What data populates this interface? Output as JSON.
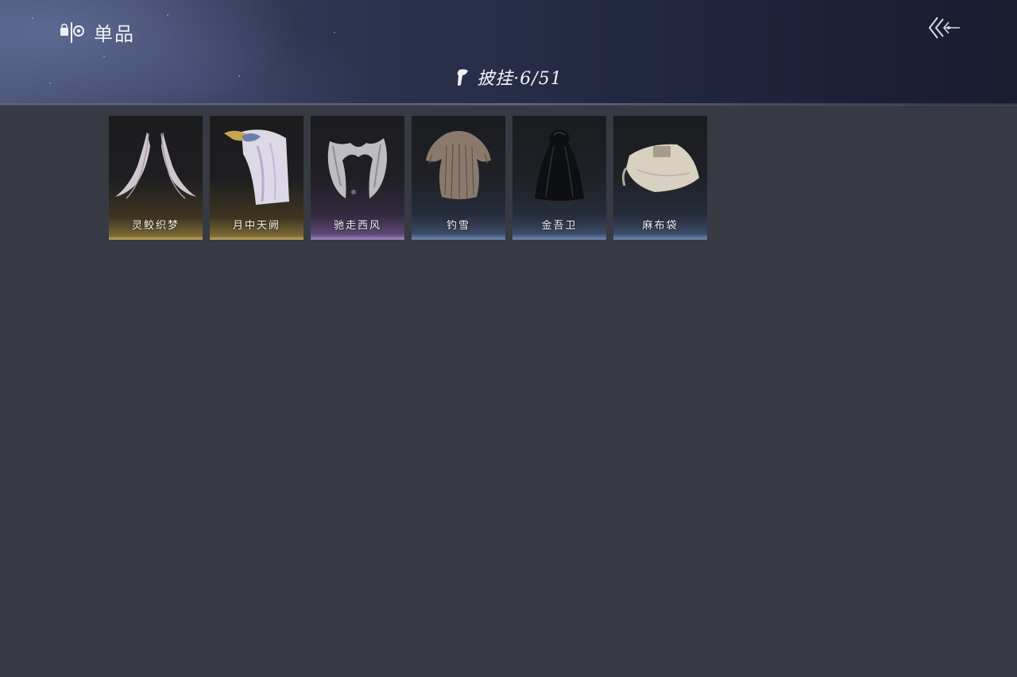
{
  "header": {
    "section_label": "单品",
    "section_icon": "wardrobe-icon",
    "back_icon": "back-arrow-icon"
  },
  "category": {
    "icon": "cape-icon",
    "label": "披挂·6/51"
  },
  "items": [
    {
      "name": "灵鲛织梦",
      "rarity_color": "#c9ad5e",
      "icon": "silk-ribbon-cape"
    },
    {
      "name": "月中天阙",
      "rarity_color": "#c9ad5e",
      "icon": "white-feather-cloak"
    },
    {
      "name": "驰走西风",
      "rarity_color": "#a58ac9",
      "icon": "fur-shawl"
    },
    {
      "name": "钓雪",
      "rarity_color": "#6f8bb8",
      "icon": "straw-raincoat"
    },
    {
      "name": "金吾卫",
      "rarity_color": "#6f8bb8",
      "icon": "black-hooded-cloak"
    },
    {
      "name": "麻布袋",
      "rarity_color": "#6f8bb8",
      "icon": "burlap-sack"
    }
  ]
}
